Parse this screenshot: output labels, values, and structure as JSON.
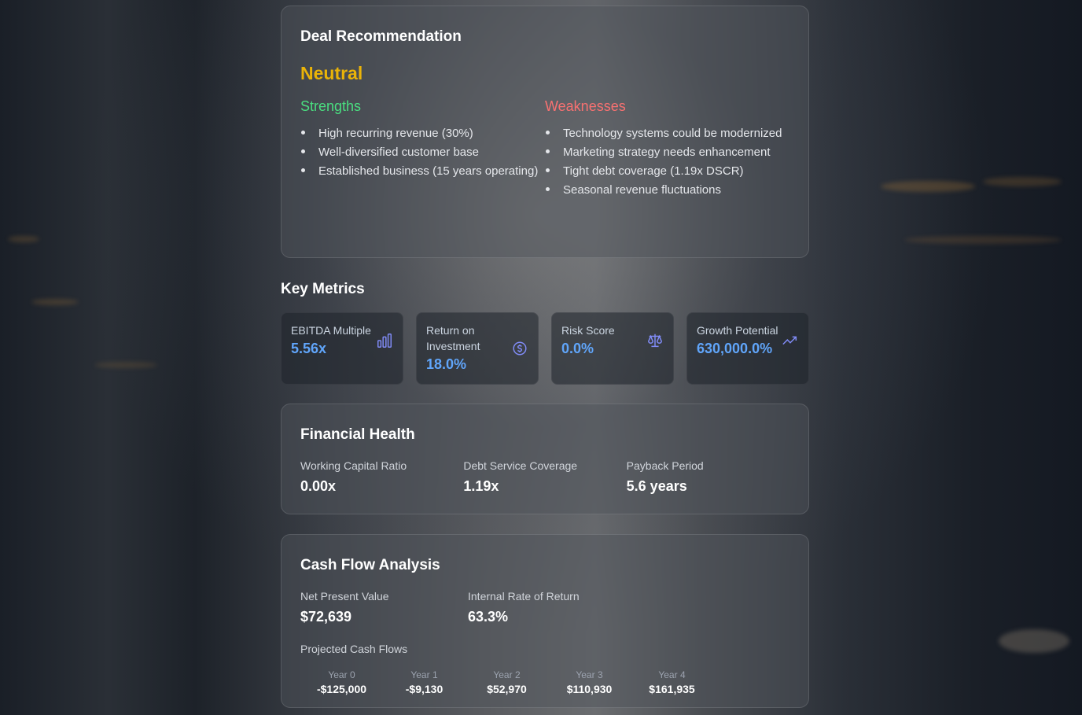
{
  "deal": {
    "title": "Deal Recommendation",
    "verdict": "Neutral",
    "strengths_title": "Strengths",
    "strengths": [
      "High recurring revenue (30%)",
      "Well-diversified customer base",
      "Established business (15 years operating)"
    ],
    "weaknesses_title": "Weaknesses",
    "weaknesses": [
      "Technology systems could be modernized",
      "Marketing strategy needs enhancement",
      "Tight debt coverage (1.19x DSCR)",
      "Seasonal revenue fluctuations"
    ],
    "colors": {
      "verdict": "#eab308",
      "strengths": "#4ade80",
      "weaknesses": "#f87171"
    }
  },
  "key_metrics": {
    "title": "Key Metrics",
    "items": [
      {
        "label": "EBITDA Multiple",
        "value": "5.56x",
        "icon": "bar-chart-icon"
      },
      {
        "label": "Return on Investment",
        "value": "18.0%",
        "icon": "dollar-circle-icon"
      },
      {
        "label": "Risk Score",
        "value": "0.0%",
        "icon": "scale-icon"
      },
      {
        "label": "Growth Potential",
        "value": "630,000.0%",
        "icon": "trending-up-icon"
      }
    ]
  },
  "financial_health": {
    "title": "Financial Health",
    "items": [
      {
        "label": "Working Capital Ratio",
        "value": "0.00x"
      },
      {
        "label": "Debt Service Coverage",
        "value": "1.19x"
      },
      {
        "label": "Payback Period",
        "value": "5.6 years"
      }
    ]
  },
  "cash_flow": {
    "title": "Cash Flow Analysis",
    "items": [
      {
        "label": "Net Present Value",
        "value": "$72,639"
      },
      {
        "label": "Internal Rate of Return",
        "value": "63.3%"
      }
    ],
    "projected_title": "Projected Cash Flows",
    "projected": [
      {
        "year": "Year 0",
        "amount": "-$125,000"
      },
      {
        "year": "Year 1",
        "amount": "-$9,130"
      },
      {
        "year": "Year 2",
        "amount": "$52,970"
      },
      {
        "year": "Year 3",
        "amount": "$110,930"
      },
      {
        "year": "Year 4",
        "amount": "$161,935"
      }
    ]
  }
}
